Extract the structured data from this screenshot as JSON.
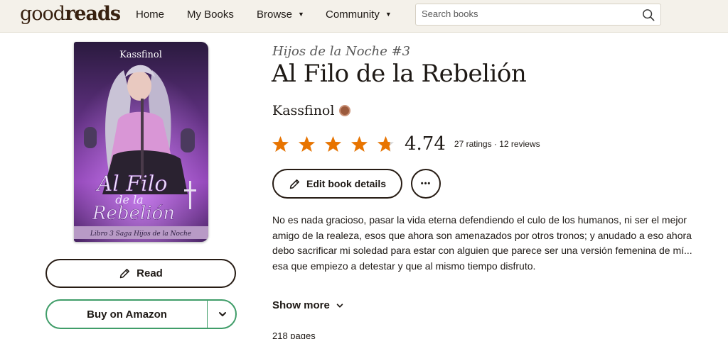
{
  "header": {
    "logo_prefix": "good",
    "logo_suffix": "reads",
    "nav": {
      "home": "Home",
      "my_books": "My Books",
      "browse": "Browse",
      "community": "Community"
    },
    "search_placeholder": "Search books"
  },
  "cover": {
    "author_text": "Kassfinol",
    "title_line1": "Al Filo",
    "title_line2": "de la",
    "title_line3": "Rebelión",
    "subtitle": "Libro 3 Saga Hijos de la Noche"
  },
  "book": {
    "series": "Hijos de la Noche #3",
    "title": "Al Filo de la Rebelión",
    "author": "Kassfinol",
    "average_rating": "4.74",
    "rating_value": 4.74,
    "rating_counts": "27 ratings · 12 reviews",
    "description": "No es nada gracioso, pasar la vida eterna defendiendo el culo de los humanos, ni ser el mejor amigo de la realeza, esos que ahora son amenazados por otros tronos; y anudado a eso ahora debo sacrificar mi soledad para estar con alguien que parece ser una versión femenina de mí... esa que empiezo a detestar y que al mismo tiempo disfruto.",
    "pages": "218 pages"
  },
  "actions": {
    "read_label": "Read",
    "buy_label": "Buy on Amazon",
    "edit_label": "Edit book details",
    "more_label": "•••",
    "show_more_label": "Show more"
  },
  "colors": {
    "header_bg": "#f4f1ea",
    "star": "#e87400",
    "amazon_border": "#409d69",
    "text": "#1e1915"
  }
}
